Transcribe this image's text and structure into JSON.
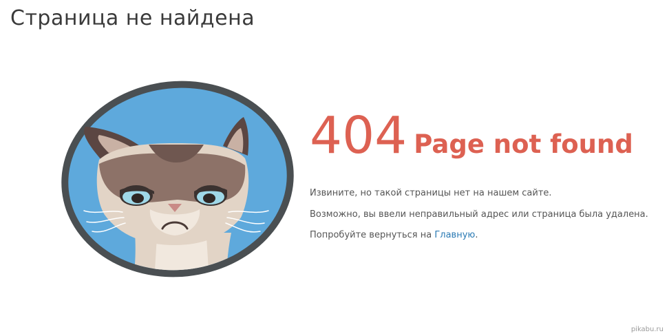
{
  "page": {
    "title": "Страница не найдена"
  },
  "error": {
    "code": "404",
    "headline": "Page not found"
  },
  "messages": {
    "line1": "Извините, но такой страницы нет на нашем сайте.",
    "line2": "Возможно, вы ввели неправильный адрес или страница была удалена.",
    "line3_prefix": "Попробуйте вернуться на ",
    "home_link": "Главную",
    "line3_suffix": "."
  },
  "watermark": "pikabu.ru",
  "colors": {
    "accent": "#dd6152",
    "link": "#2a7ab4",
    "frame": "#4a4f52",
    "sky": "#5ea9dc"
  },
  "illustration": {
    "icon": "grumpy-cat-illustration"
  }
}
